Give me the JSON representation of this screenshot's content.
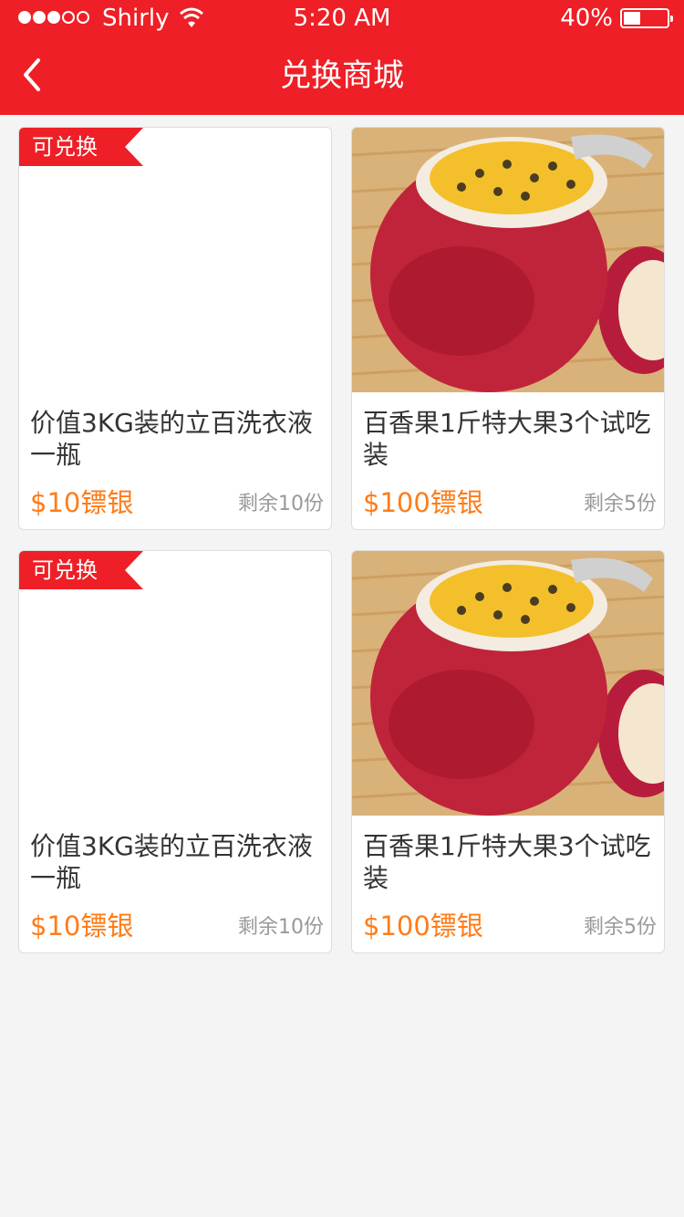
{
  "status_bar": {
    "carrier": "Shirly",
    "time": "5:20 AM",
    "battery_pct": "40%",
    "battery_level": 0.4,
    "signal_bars": 3,
    "signal_total": 5
  },
  "nav": {
    "title": "兑换商城",
    "back_icon": "chevron-left-icon"
  },
  "colors": {
    "accent": "#ee1f26",
    "price": "#ff7c1a",
    "background": "#f4f4f4"
  },
  "products": [
    {
      "badge": "可兑换",
      "image": "detergent-bottle",
      "name": "价值3KG装的立百洗衣液一瓶",
      "price": "$10镖银",
      "remaining": "剩余10份"
    },
    {
      "badge": "",
      "image": "passion-fruit",
      "name": "百香果1斤特大果3个试吃装",
      "price": "$100镖银",
      "remaining": "剩余5份"
    },
    {
      "badge": "可兑换",
      "image": "detergent-bottle",
      "name": "价值3KG装的立百洗衣液一瓶",
      "price": "$10镖银",
      "remaining": "剩余10份"
    },
    {
      "badge": "",
      "image": "passion-fruit",
      "name": "百香果1斤特大果3个试吃装",
      "price": "$100镖银",
      "remaining": "剩余5份"
    }
  ]
}
